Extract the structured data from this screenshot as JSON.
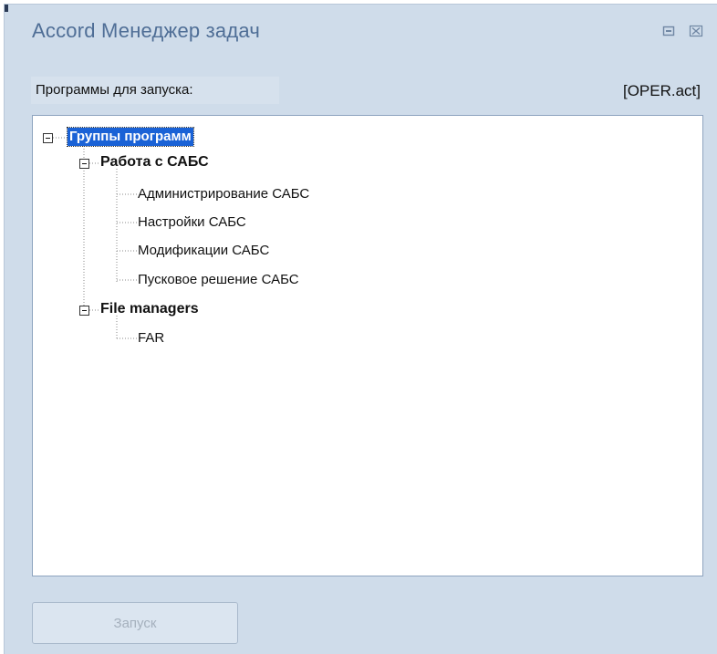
{
  "window": {
    "title": "Accord Менеджер задач",
    "restore_icon": "restore-icon",
    "close_icon": "close-icon"
  },
  "programs_label": "Программы для запуска:",
  "config_name": "[OPER.act]",
  "tree": {
    "root": {
      "label": "Группы программ",
      "selected": true,
      "expanded": true
    },
    "groups": [
      {
        "label": "Работа с САБС",
        "expanded": true,
        "items": [
          "Администрирование САБС",
          "Настройки САБС",
          "Модификации САБС",
          "Пусковое решение САБС"
        ]
      },
      {
        "label": "File managers",
        "expanded": true,
        "items": [
          "FAR"
        ]
      }
    ]
  },
  "run_button": {
    "label": "Запуск",
    "enabled": false
  },
  "colors": {
    "window_bg": "#cfdcea",
    "title": "#4f6e96",
    "selection": "#1a62d6"
  }
}
